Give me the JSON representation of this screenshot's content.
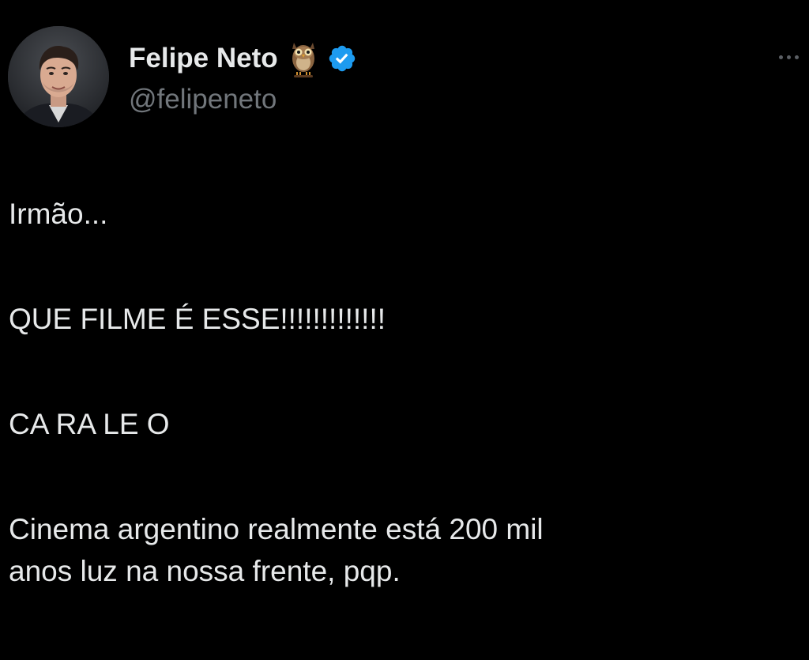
{
  "author": {
    "display_name": "Felipe Neto",
    "handle": "@felipeneto",
    "name_emoji": "owl-emoji",
    "verified_badge": "verified-check-icon",
    "badge_color": "#1d9bf0"
  },
  "more_menu": {
    "icon": "more-horizontal-icon"
  },
  "tweet": {
    "lines": [
      "Irmão...",
      "QUE FILME É ESSE!!!!!!!!!!!!!",
      "CA RA LE O",
      "Cinema argentino realmente está 200 mil",
      "anos luz na nossa frente, pqp."
    ]
  },
  "colors": {
    "background": "#000000",
    "primary_text": "#e7e9ea",
    "secondary_text": "#71767b"
  }
}
